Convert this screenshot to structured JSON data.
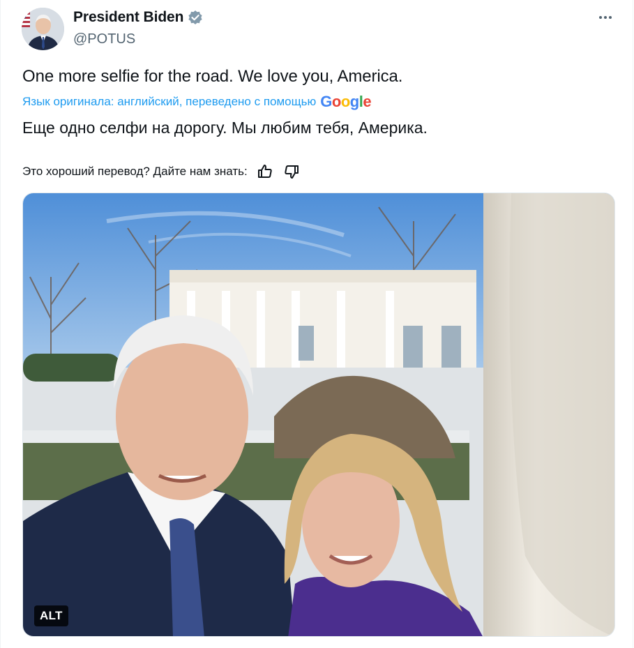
{
  "author": {
    "display_name": "President Biden",
    "handle": "@POTUS",
    "avatar_icon": "user-avatar",
    "verified_icon": "verified-badge-icon",
    "verified_color": "#829aab"
  },
  "tweet": {
    "text": "One more selfie for the road. We love you, America.",
    "translation_label": "Язык оригинала: английский, переведено с помощью",
    "translation_provider": "Google",
    "translated_text": "Еще одно селфи на дорогу. Мы любим тебя, Америка.",
    "feedback_prompt": "Это хороший перевод? Дайте нам знать:"
  },
  "media": {
    "alt_label": "ALT"
  },
  "colors": {
    "link": "#1d9bf0",
    "secondary_text": "#536471",
    "primary_text": "#0f1419"
  }
}
